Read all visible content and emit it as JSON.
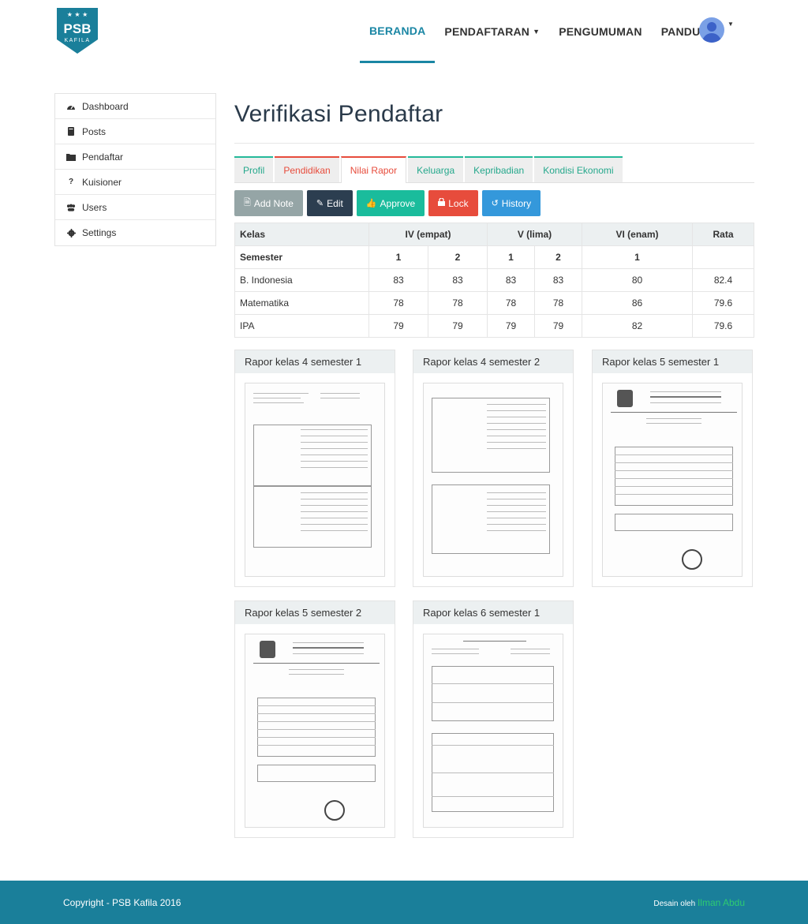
{
  "header": {
    "logo": {
      "main": "PSB",
      "sub": "KAFILA"
    },
    "nav": [
      {
        "label": "BERANDA",
        "active": true
      },
      {
        "label": "PENDAFTARAN",
        "dropdown": true
      },
      {
        "label": "PENGUMUMAN"
      },
      {
        "label": "PANDUAN"
      }
    ],
    "avatar_icon": "user-avatar-icon"
  },
  "sidebar": {
    "items": [
      {
        "label": "Dashboard",
        "icon": "dashboard-icon"
      },
      {
        "label": "Posts",
        "icon": "book-icon"
      },
      {
        "label": "Pendaftar",
        "icon": "folder-icon"
      },
      {
        "label": "Kuisioner",
        "icon": "question-icon"
      },
      {
        "label": "Users",
        "icon": "users-icon"
      },
      {
        "label": "Settings",
        "icon": "cog-icon"
      }
    ]
  },
  "main": {
    "title": "Verifikasi Pendaftar",
    "tabs": [
      {
        "label": "Profil"
      },
      {
        "label": "Pendidikan"
      },
      {
        "label": "Nilai Rapor",
        "active": true
      },
      {
        "label": "Keluarga"
      },
      {
        "label": "Kepribadian"
      },
      {
        "label": "Kondisi Ekonomi"
      }
    ],
    "buttons": [
      {
        "label": "Add Note",
        "icon": "note-icon"
      },
      {
        "label": "Edit",
        "icon": "edit-icon"
      },
      {
        "label": "Approve",
        "icon": "thumbs-up-icon"
      },
      {
        "label": "Lock",
        "icon": "lock-icon"
      },
      {
        "label": "History",
        "icon": "history-icon"
      }
    ],
    "table": {
      "head": {
        "kelas": "Kelas",
        "g4": "IV (empat)",
        "g5": "V (lima)",
        "g6": "VI (enam)",
        "rata": "Rata"
      },
      "semester_label": "Semester",
      "semesters": [
        "1",
        "2",
        "1",
        "2",
        "1"
      ],
      "rows": [
        {
          "subject": "B. Indonesia",
          "values": [
            "83",
            "83",
            "83",
            "83",
            "80"
          ],
          "avg": "82.4"
        },
        {
          "subject": "Matematika",
          "values": [
            "78",
            "78",
            "78",
            "78",
            "86"
          ],
          "avg": "79.6"
        },
        {
          "subject": "IPA",
          "values": [
            "79",
            "79",
            "79",
            "79",
            "82"
          ],
          "avg": "79.6"
        }
      ]
    },
    "rapor_panels": [
      {
        "title": "Rapor kelas 4 semester 1"
      },
      {
        "title": "Rapor kelas 4 semester 2"
      },
      {
        "title": "Rapor kelas 5 semester 1"
      },
      {
        "title": "Rapor kelas 5 semester 2"
      },
      {
        "title": "Rapor kelas 6 semester 1"
      }
    ]
  },
  "footer": {
    "copyright": "Copyright - PSB Kafila 2016",
    "credit_prefix": "Desain oleh",
    "credit_name": "Ilman Abdu"
  },
  "colors": {
    "primary": "#1a86a4",
    "footer": "#1a7f9a",
    "tab_green": "#25b99a",
    "tab_red": "#e74c3c"
  }
}
